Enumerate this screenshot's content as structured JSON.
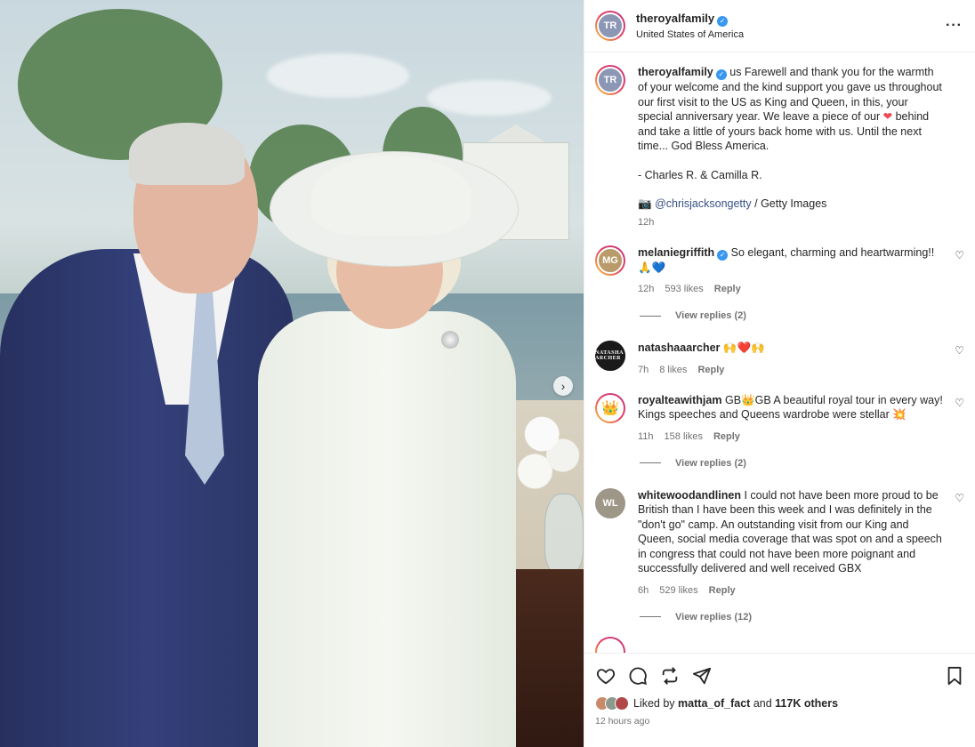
{
  "header": {
    "username": "theroyalfamily",
    "location": "United States of America"
  },
  "caption": {
    "username": "theroyalfamily",
    "text_1": "us Farewell and thank you for the warmth of your welcome and the kind support you gave us throughout our first visit to the US as King and Queen, in this, your special anniversary year. We leave a piece of our",
    "heart": "❤",
    "text_2": "behind and take a little of yours back home with us. Until the next time... God Bless America.",
    "signature": "- Charles R. & Camilla R.",
    "camera": "📷",
    "credit_handle": "@chrisjacksongetty",
    "credit_rest": "/ Getty Images",
    "time": "12h"
  },
  "comments": [
    {
      "username": "melaniegriffith",
      "verified": true,
      "text": "So elegant, charming and heartwarming!! 🙏💙",
      "time": "12h",
      "likes": "593 likes",
      "reply": "Reply",
      "view_replies": "View replies (2)"
    },
    {
      "username": "natashaaarcher",
      "verified": false,
      "text": "🙌❤️🙌",
      "time": "7h",
      "likes": "8 likes",
      "reply": "Reply"
    },
    {
      "username": "royalteawithjam",
      "verified": false,
      "text": "GB👑GB A beautiful royal tour in every way! Kings speeches and Queens wardrobe were stellar 💥",
      "time": "11h",
      "likes": "158 likes",
      "reply": "Reply",
      "view_replies": "View replies (2)"
    },
    {
      "username": "whitewoodandlinen",
      "verified": false,
      "text": "I could not have been more proud to be British than I have been this week and I was definitely in the \"don't go\" camp. An outstanding visit from our King and Queen, social media coverage that was spot on and a speech in congress that could not have been more poignant and successfully delivered and well received GBX",
      "time": "6h",
      "likes": "529 likes",
      "reply": "Reply",
      "view_replies": "View replies (12)"
    }
  ],
  "footer": {
    "liked_by_prefix": "Liked by",
    "liked_by_user": "matta_of_fact",
    "liked_by_and": "and",
    "liked_by_count": "117K others",
    "time": "12 hours ago"
  },
  "avatar_initials": {
    "theroyalfamily": "TR",
    "melaniegriffith": "MG",
    "natashaaarcher": "NATASHA ARCHER",
    "royalteawithjam": "👑",
    "whitewoodandlinen": "WL"
  },
  "colors": {
    "verified": "#3897f0",
    "link": "#385185",
    "like_red": "#ed4956"
  }
}
